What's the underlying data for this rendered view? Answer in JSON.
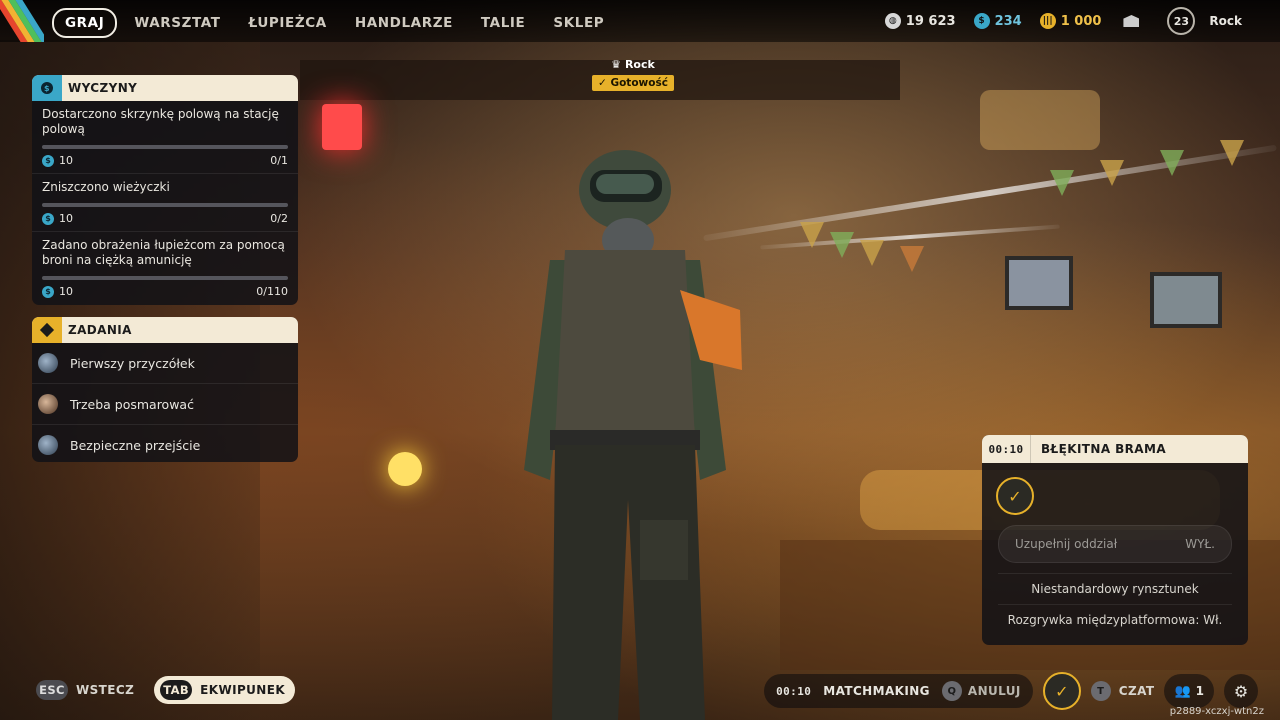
{
  "colors": {
    "accent_yellow": "#e7b12a",
    "panel_cream": "#f3ead6",
    "challenge_blue": "#3aa7c8"
  },
  "nav": {
    "tabs": [
      {
        "label": "GRAJ"
      },
      {
        "label": "WARSZTAT"
      },
      {
        "label": "ŁUPIEŻCA"
      },
      {
        "label": "HANDLARZE"
      },
      {
        "label": "TALIE"
      },
      {
        "label": "SKLEP"
      }
    ]
  },
  "currencies": {
    "coins": "19 623",
    "tokens": "234",
    "raider": "1 000",
    "level": "23",
    "username": "Rock"
  },
  "challenges": {
    "title": "WYCZYNY",
    "items": [
      {
        "text": "Dostarczono skrzynkę polową na stację polową",
        "reward": "10",
        "progress": "0/1",
        "fraction": 0
      },
      {
        "text": "Zniszczono wieżyczki",
        "reward": "10",
        "progress": "0/2",
        "fraction": 0
      },
      {
        "text": "Zadano obrażenia łupieżcom za pomocą broni na ciężką amunicję",
        "reward": "10",
        "progress": "0/110",
        "fraction": 0
      }
    ]
  },
  "tasks": {
    "title": "ZADANIA",
    "items": [
      {
        "label": "Pierwszy przyczółek"
      },
      {
        "label": "Trzeba posmarować"
      },
      {
        "label": "Bezpieczne przejście"
      }
    ]
  },
  "player": {
    "name": "Rock",
    "status": "Gotowość"
  },
  "lobby": {
    "timer": "00:10",
    "map": "BŁĘKITNA BRAMA",
    "fill_label": "Uzupełnij oddział",
    "fill_value": "WYŁ.",
    "option1": "Niestandardowy rynsztunek",
    "option2": "Rozgrywka międzyplatformowa: Wł."
  },
  "bottom": {
    "esc_key": "ESC",
    "back_label": "WSTECZ",
    "tab_key": "TAB",
    "inventory_label": "EKWIPUNEK",
    "mm_timer": "00:10",
    "mm_label": "MATCHMAKING",
    "cancel_key": "Q",
    "cancel_label": "ANULUJ",
    "chat_key": "T",
    "chat_label": "CZAT",
    "party_count": "1",
    "session_id": "p2889-xczxj-wtn2z"
  }
}
